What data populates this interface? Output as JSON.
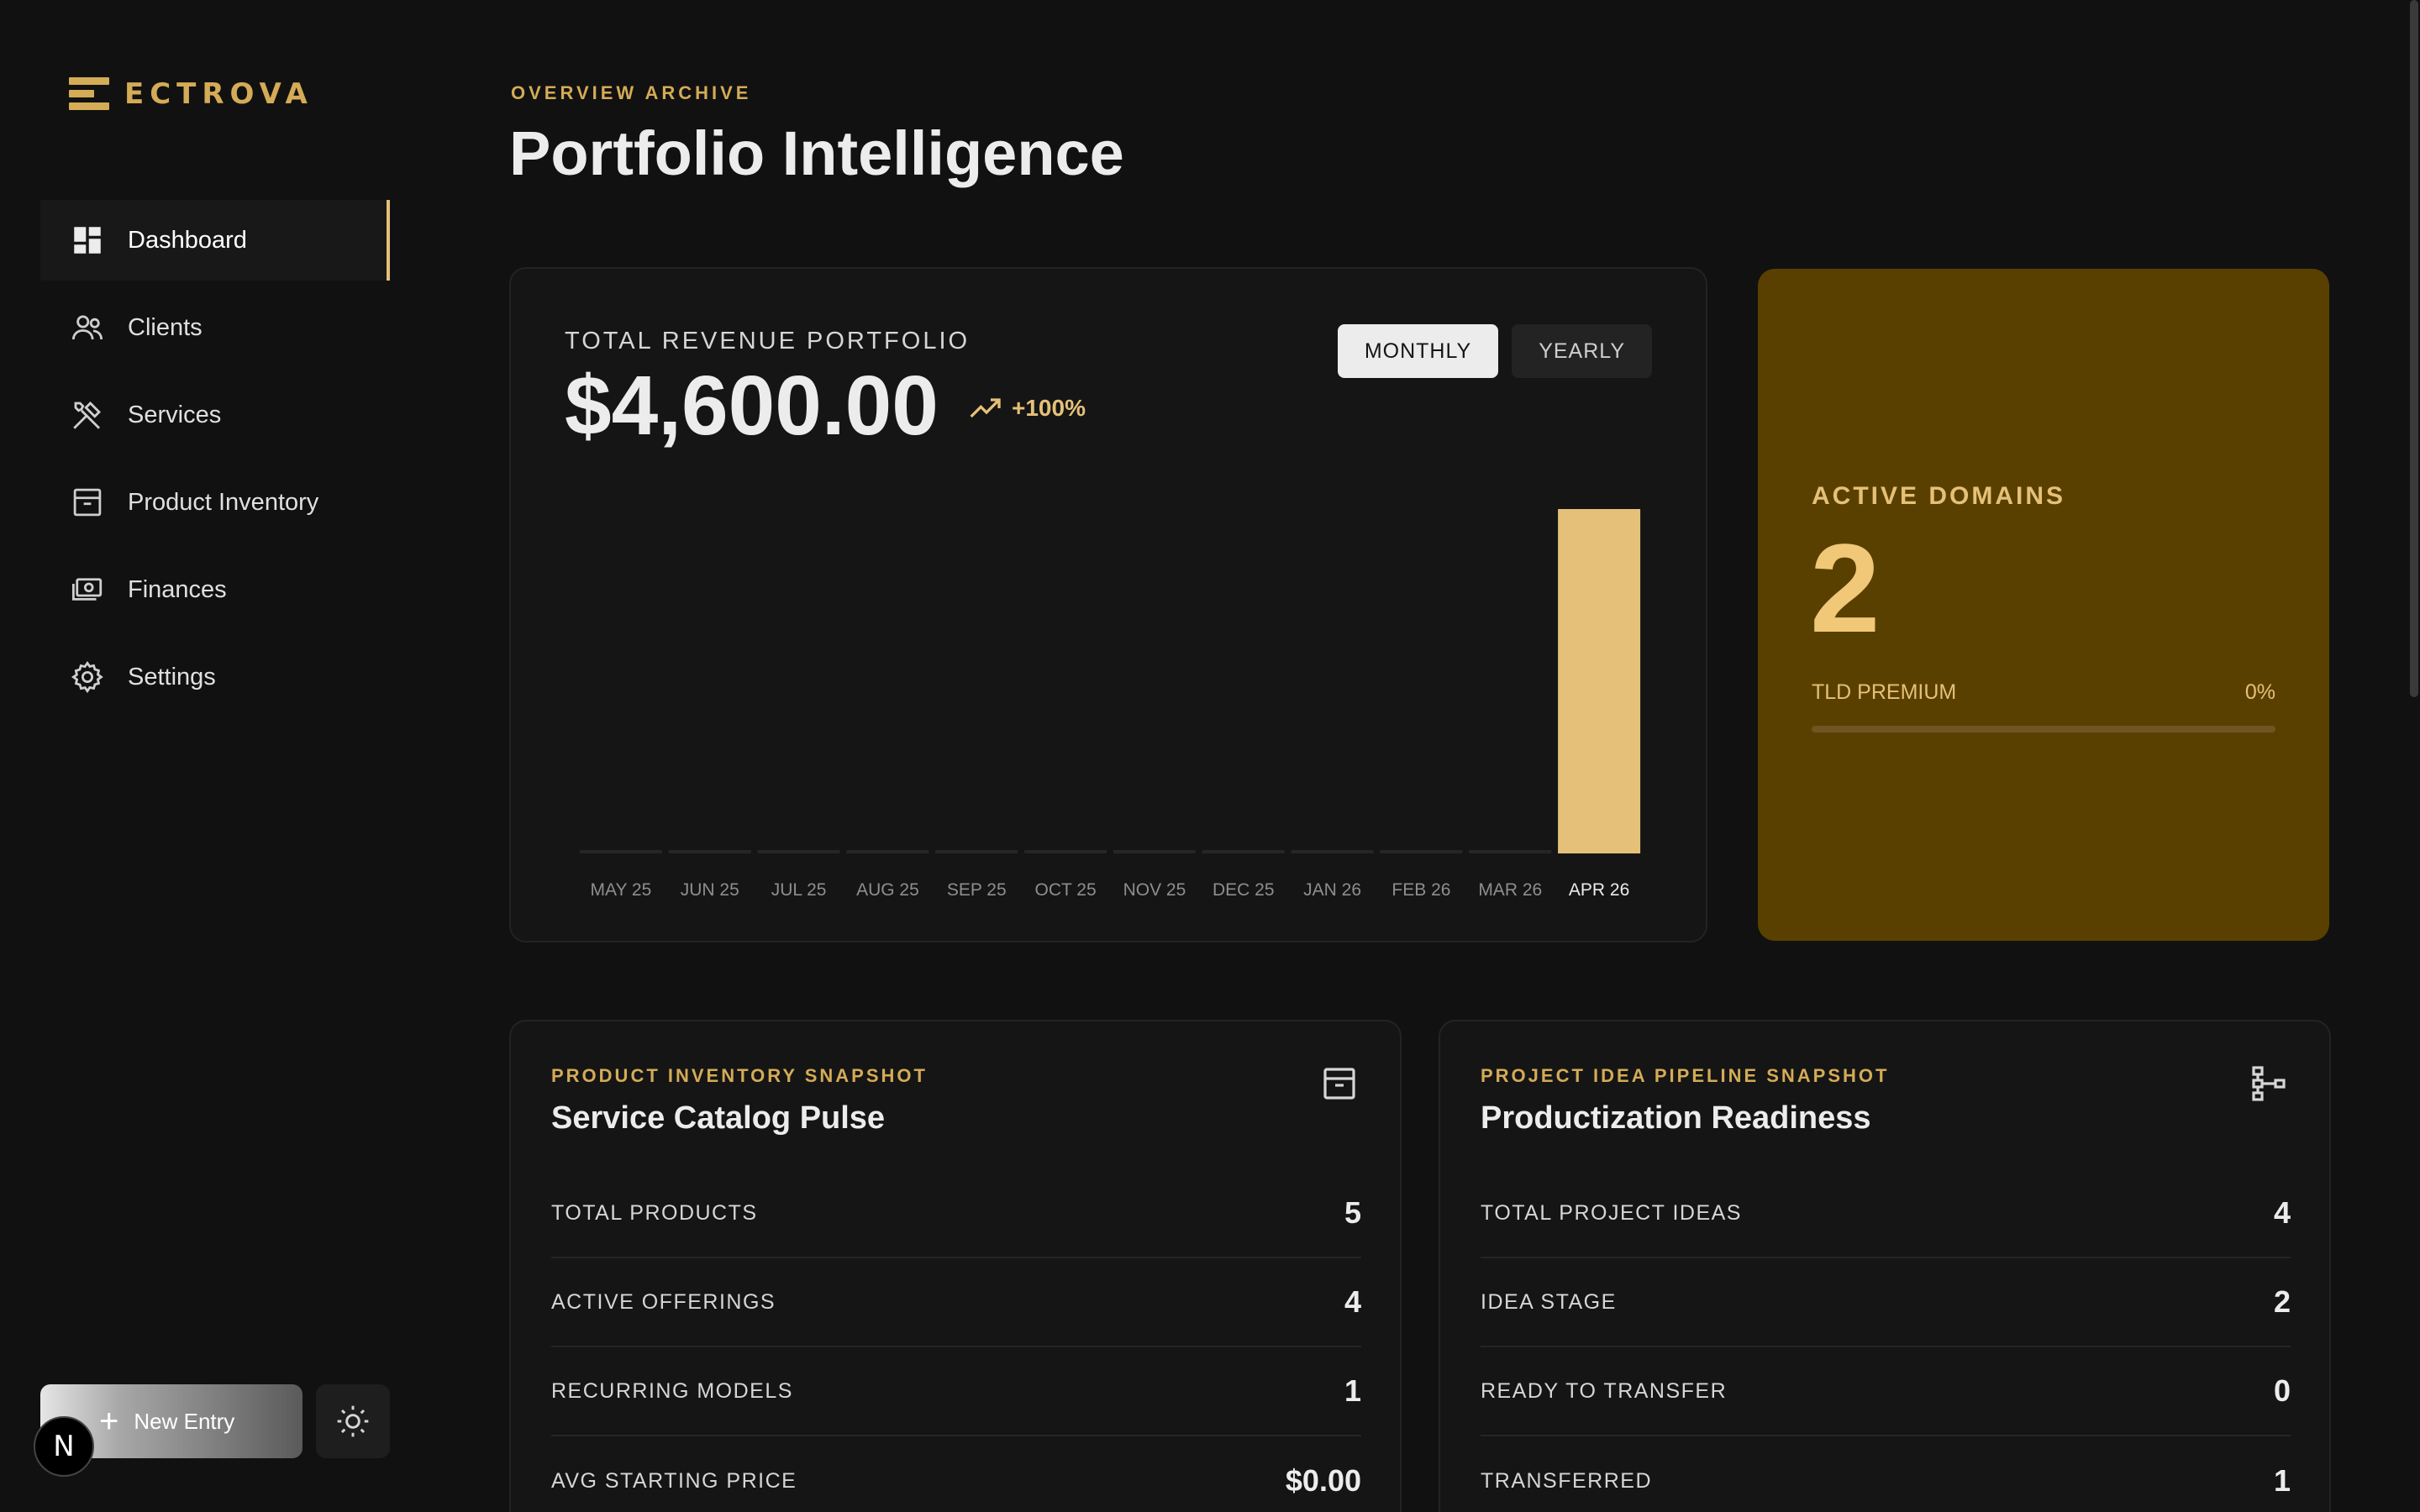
{
  "brand": {
    "name": "ECTROVA",
    "accent": "#d4ab56"
  },
  "sidebar": {
    "items": [
      {
        "label": "Dashboard",
        "icon": "dashboard-icon",
        "active": true
      },
      {
        "label": "Clients",
        "icon": "users-icon",
        "active": false
      },
      {
        "label": "Services",
        "icon": "tools-icon",
        "active": false
      },
      {
        "label": "Product Inventory",
        "icon": "archive-icon",
        "active": false
      },
      {
        "label": "Finances",
        "icon": "money-icon",
        "active": false
      },
      {
        "label": "Settings",
        "icon": "gear-icon",
        "active": false
      }
    ],
    "new_entry_label": "New Entry",
    "theme_icon": "sun-icon",
    "badge_letter": "N"
  },
  "header": {
    "eyebrow": "OVERVIEW ARCHIVE",
    "title": "Portfolio Intelligence"
  },
  "revenue": {
    "label": "TOTAL REVENUE PORTFOLIO",
    "value": "$4,600.00",
    "trend": "+100%",
    "toggles": {
      "monthly": "MONTHLY",
      "yearly": "YEARLY",
      "selected": "MONTHLY"
    }
  },
  "chart_data": {
    "type": "bar",
    "categories": [
      "MAY 25",
      "JUN 25",
      "JUL 25",
      "AUG 25",
      "SEP 25",
      "OCT 25",
      "NOV 25",
      "DEC 25",
      "JAN 26",
      "FEB 26",
      "MAR 26",
      "APR 26"
    ],
    "values": [
      0,
      0,
      0,
      0,
      0,
      0,
      0,
      0,
      0,
      0,
      0,
      4600
    ],
    "ylim": [
      0,
      4600
    ],
    "grid": false,
    "highlight_color": "#e5c078"
  },
  "domains": {
    "label": "ACTIVE DOMAINS",
    "value": "2",
    "sub_label": "TLD PREMIUM",
    "sub_value": "0%",
    "progress": 0
  },
  "inventory": {
    "eyebrow": "PRODUCT INVENTORY SNAPSHOT",
    "title": "Service Catalog Pulse",
    "icon": "archive-icon",
    "rows": [
      {
        "label": "TOTAL PRODUCTS",
        "value": "5"
      },
      {
        "label": "ACTIVE OFFERINGS",
        "value": "4"
      },
      {
        "label": "RECURRING MODELS",
        "value": "1"
      },
      {
        "label": "AVG STARTING PRICE",
        "value": "$0.00"
      }
    ]
  },
  "pipeline": {
    "eyebrow": "PROJECT IDEA PIPELINE SNAPSHOT",
    "title": "Productization Readiness",
    "icon": "hierarchy-icon",
    "rows": [
      {
        "label": "TOTAL PROJECT IDEAS",
        "value": "4"
      },
      {
        "label": "IDEA STAGE",
        "value": "2"
      },
      {
        "label": "READY TO TRANSFER",
        "value": "0"
      },
      {
        "label": "TRANSFERRED",
        "value": "1"
      }
    ]
  }
}
